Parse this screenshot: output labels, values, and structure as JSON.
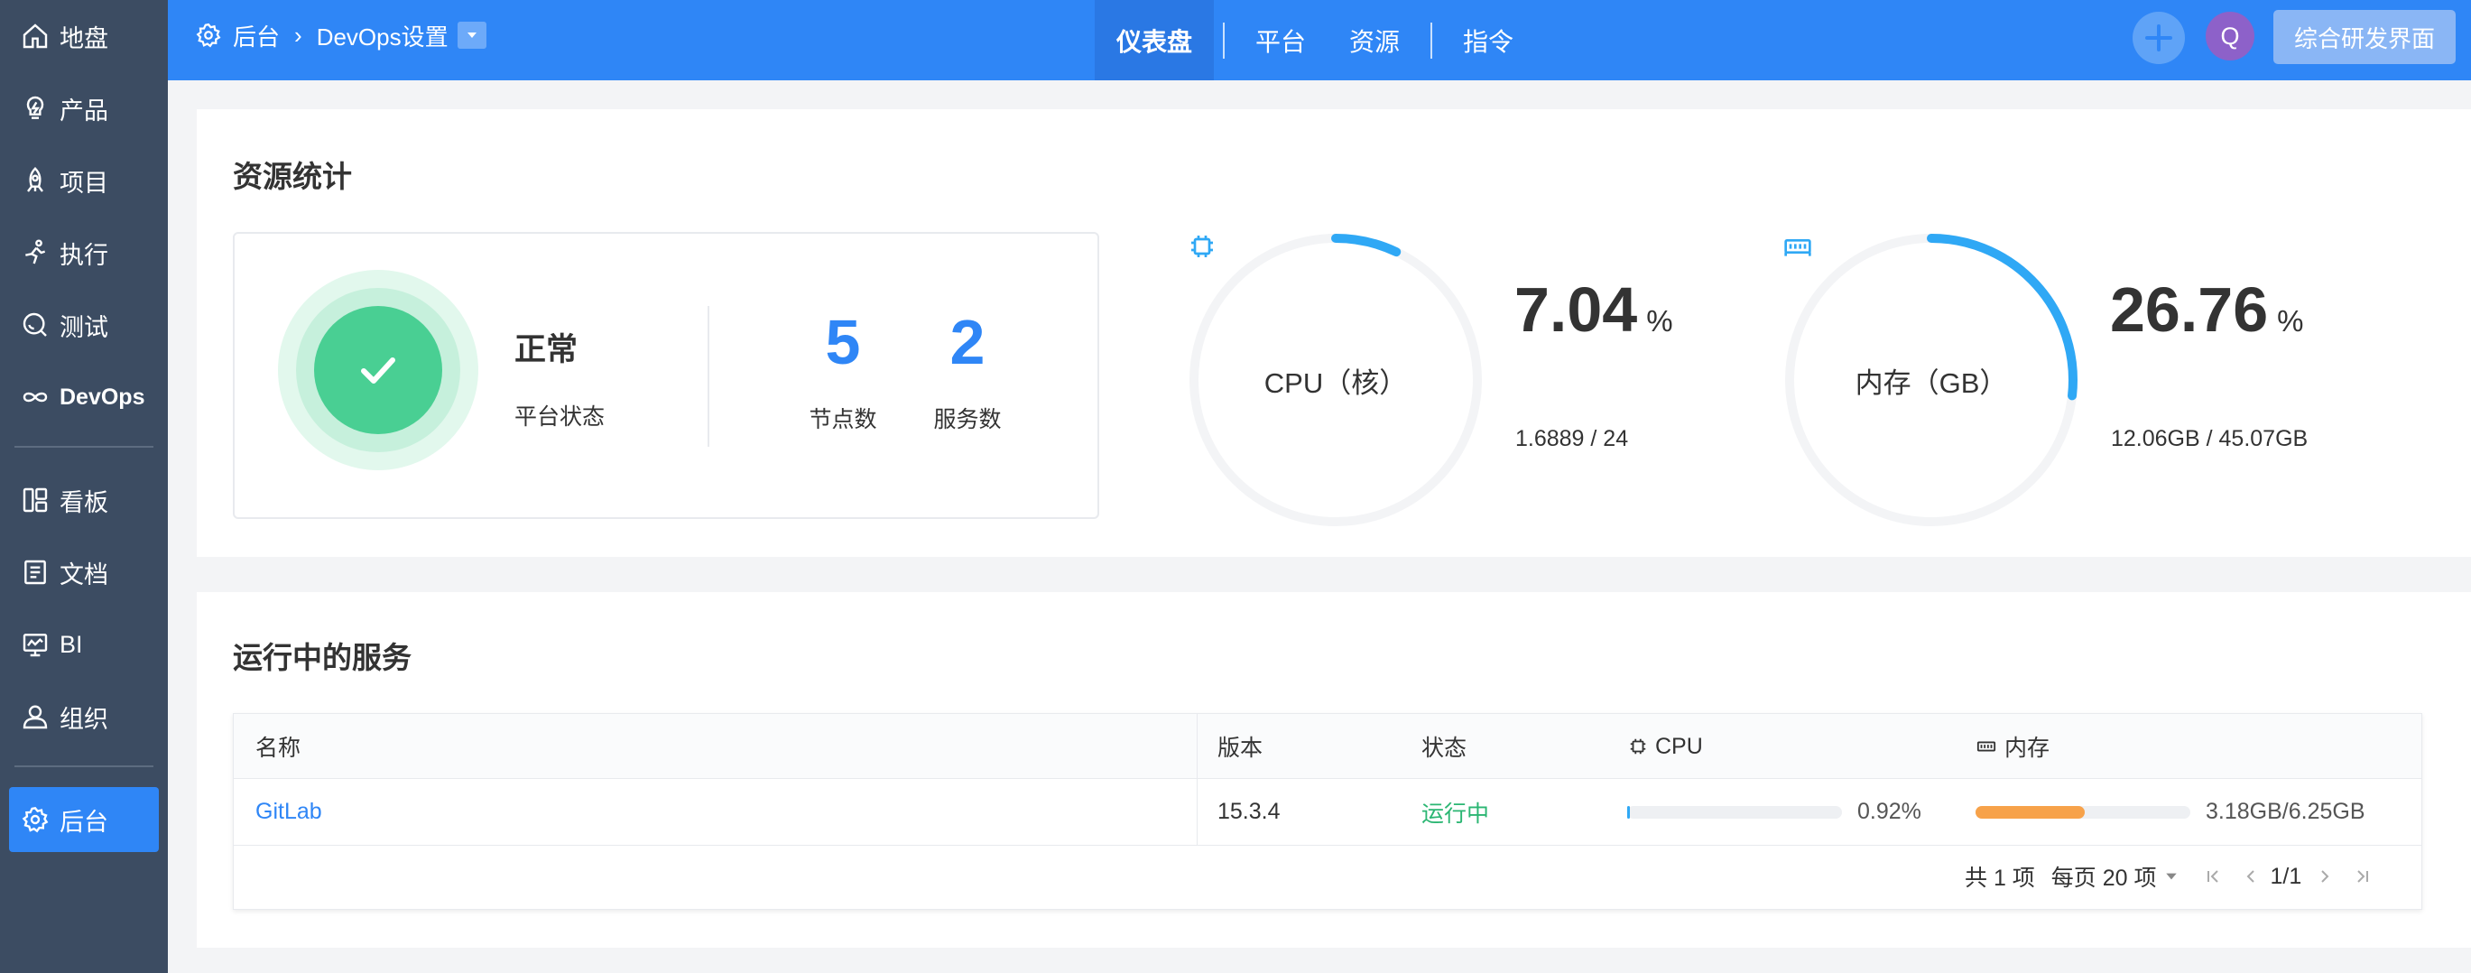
{
  "sidebar": {
    "items": [
      {
        "label": "地盘",
        "icon": "home-icon"
      },
      {
        "label": "产品",
        "icon": "bulb-icon"
      },
      {
        "label": "项目",
        "icon": "rocket-icon"
      },
      {
        "label": "执行",
        "icon": "run-icon"
      },
      {
        "label": "测试",
        "icon": "search-icon"
      },
      {
        "label": "DevOps",
        "icon": "infinity-icon"
      },
      {
        "label": "看板",
        "icon": "kanban-icon"
      },
      {
        "label": "文档",
        "icon": "document-icon"
      },
      {
        "label": "BI",
        "icon": "monitor-icon"
      },
      {
        "label": "组织",
        "icon": "user-icon"
      },
      {
        "label": "后台",
        "icon": "gear-icon"
      }
    ]
  },
  "header": {
    "breadcrumb": {
      "root": "后台",
      "current": "DevOps设置"
    },
    "tabs": [
      {
        "label": "仪表盘"
      },
      {
        "label": "平台"
      },
      {
        "label": "资源"
      },
      {
        "label": "指令"
      }
    ],
    "avatar_letter": "Q",
    "portal_button": "综合研发界面"
  },
  "resource_stats": {
    "title": "资源统计",
    "status": {
      "label": "正常",
      "sub": "平台状态"
    },
    "nodes": {
      "value": "5",
      "label": "节点数"
    },
    "services": {
      "value": "2",
      "label": "服务数"
    },
    "cpu": {
      "label": "CPU（核）",
      "percent": "7.04",
      "unit": "%",
      "detail": "1.6889 / 24",
      "fraction": 0.0704
    },
    "memory": {
      "label": "内存（GB）",
      "percent": "26.76",
      "unit": "%",
      "detail": "12.06GB / 45.07GB",
      "fraction": 0.2676
    }
  },
  "services_table": {
    "title": "运行中的服务",
    "columns": {
      "name": "名称",
      "version": "版本",
      "status": "状态",
      "cpu": "CPU",
      "memory": "内存"
    },
    "rows": [
      {
        "name": "GitLab",
        "version": "15.3.4",
        "status": "运行中",
        "cpu_text": "0.92%",
        "cpu_fraction": 0.0092,
        "memory_text": "3.18GB/6.25GB",
        "memory_fraction": 0.5088
      }
    ],
    "pager": {
      "total": "共 1 项",
      "per_page": "每页 20 项",
      "page": "1/1"
    }
  },
  "colors": {
    "primary": "#2f86f6",
    "sidebar": "#3c4c62",
    "success": "#49cf93",
    "gauge": "#2fa8f5",
    "memory_bar": "#f7a24a"
  }
}
